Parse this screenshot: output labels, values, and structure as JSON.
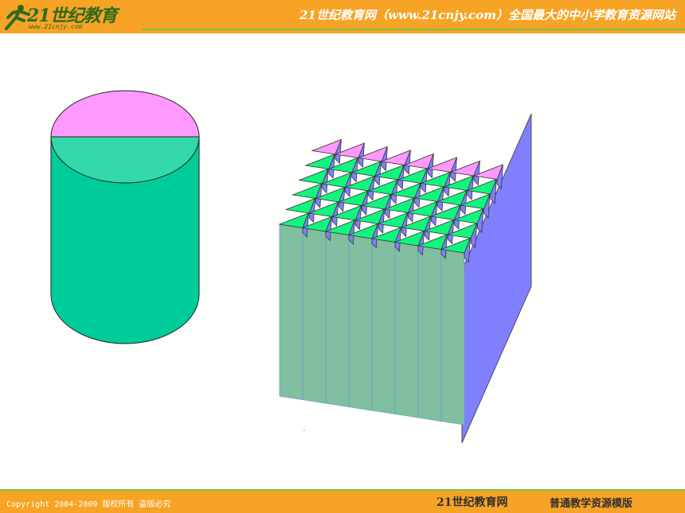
{
  "header": {
    "logo_text": "21世纪教育",
    "logo_url": "www.21cnjy.com",
    "title": "21世纪教育网（www.21cnjy.com）全国最大的中小学教育资源网站"
  },
  "footer": {
    "copyright": "Copyright 2004-2009 版权所有 盗版必究",
    "brand": "21世纪教育网",
    "template": "普通教学资源模版"
  },
  "colors": {
    "header_bg": "#f7a325",
    "accent_green": "#7cc243",
    "cylinder_top": "#ff99ff",
    "cylinder_top_front": "#33d9aa",
    "cylinder_body": "#00cc99",
    "prism_top": "#ff99ff",
    "prism_face_green": "#11f57f",
    "prism_face_blue": "#8080ff",
    "prism_front": "#80bfa0"
  },
  "figure": {
    "left_shape": "cylinder",
    "right_shape": "prism-segments",
    "segment_count": 8
  }
}
